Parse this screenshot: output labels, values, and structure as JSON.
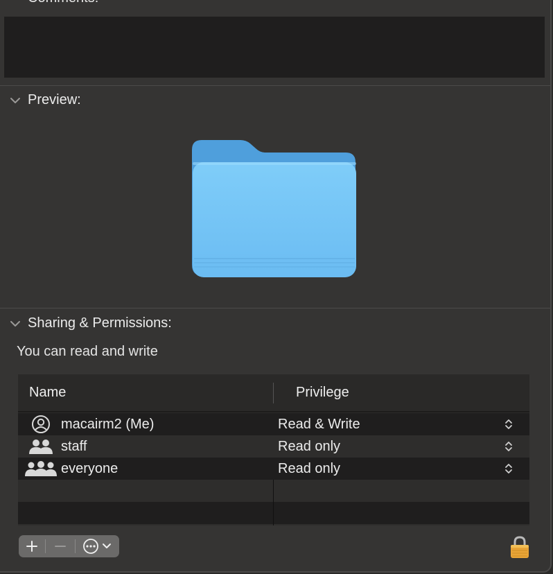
{
  "comments": {
    "title": "Comments:"
  },
  "preview": {
    "title": "Preview:",
    "icon": "folder-icon"
  },
  "sharing": {
    "title": "Sharing & Permissions:",
    "status": "You can read and write",
    "columns": {
      "name": "Name",
      "privilege": "Privilege"
    },
    "rows": [
      {
        "name": "macairm2 (Me)",
        "privilege": "Read & Write",
        "icon": "person-icon"
      },
      {
        "name": "staff",
        "privilege": "Read only",
        "icon": "group-icon"
      },
      {
        "name": "everyone",
        "privilege": "Read only",
        "icon": "everyone-icon"
      }
    ]
  },
  "toolbar": {
    "add": "add-icon",
    "remove": "remove-icon",
    "actions": "ellipsis-circle-icon"
  },
  "lock": {
    "icon": "lock-icon",
    "state": "locked"
  },
  "colors": {
    "folder": "#74c3f5",
    "background": "#353433",
    "row_dark": "#1f1e1e",
    "lock": "#e8a437"
  }
}
